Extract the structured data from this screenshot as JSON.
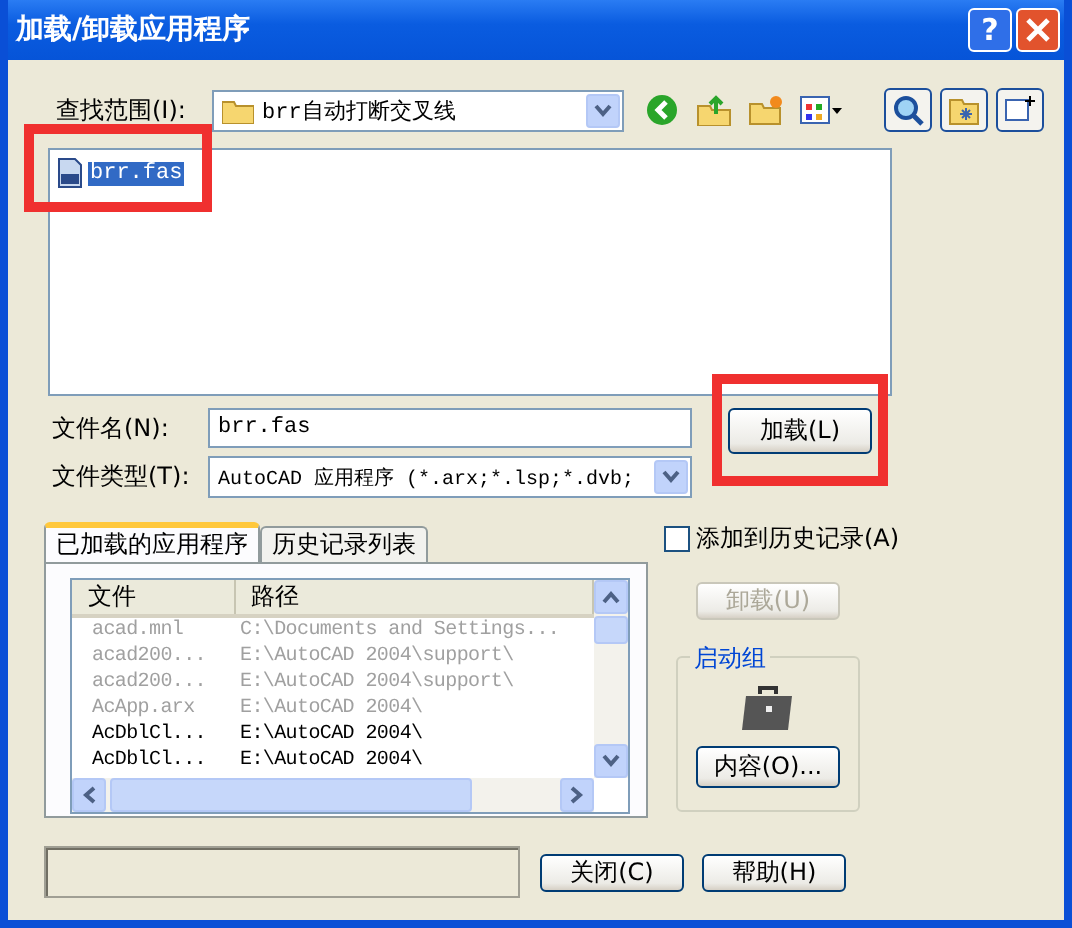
{
  "window": {
    "title": "加载/卸载应用程序",
    "help": "?"
  },
  "look_in": {
    "label": "查找范围(I):",
    "value": "brr自动打断交叉线"
  },
  "files": [
    {
      "name": "brr.fas",
      "selected": true,
      "highlighted": true
    }
  ],
  "file_name": {
    "label": "文件名(N):",
    "value": "brr.fas"
  },
  "file_type": {
    "label": "文件类型(T):",
    "value": "AutoCAD 应用程序 (*.arx;*.lsp;*.dvb;"
  },
  "load_button": {
    "label": "加载(L)",
    "highlighted": true
  },
  "tabs": [
    {
      "label": "已加载的应用程序",
      "selected": true
    },
    {
      "label": "历史记录列表",
      "selected": false
    }
  ],
  "table": {
    "columns": [
      "文件",
      "路径"
    ],
    "rows": [
      {
        "file": "acad.mnl",
        "path": "C:\\Documents and Settings...",
        "disabled": true
      },
      {
        "file": "acad200...",
        "path": "E:\\AutoCAD 2004\\support\\",
        "disabled": true
      },
      {
        "file": "acad200...",
        "path": "E:\\AutoCAD 2004\\support\\",
        "disabled": true
      },
      {
        "file": "AcApp.arx",
        "path": "E:\\AutoCAD 2004\\",
        "disabled": true
      },
      {
        "file": "AcDblCl...",
        "path": "E:\\AutoCAD 2004\\",
        "disabled": false
      },
      {
        "file": "AcDblCl...",
        "path": "E:\\AutoCAD 2004\\",
        "disabled": false
      }
    ]
  },
  "add_to_history": {
    "label": "添加到历史记录(A)",
    "checked": false
  },
  "unload_button": {
    "label": "卸载(U)",
    "disabled": true
  },
  "startup_group": {
    "title": "启动组",
    "button": "内容(O)..."
  },
  "buttons": [
    {
      "label": "关闭(C)"
    },
    {
      "label": "帮助(H)"
    }
  ]
}
